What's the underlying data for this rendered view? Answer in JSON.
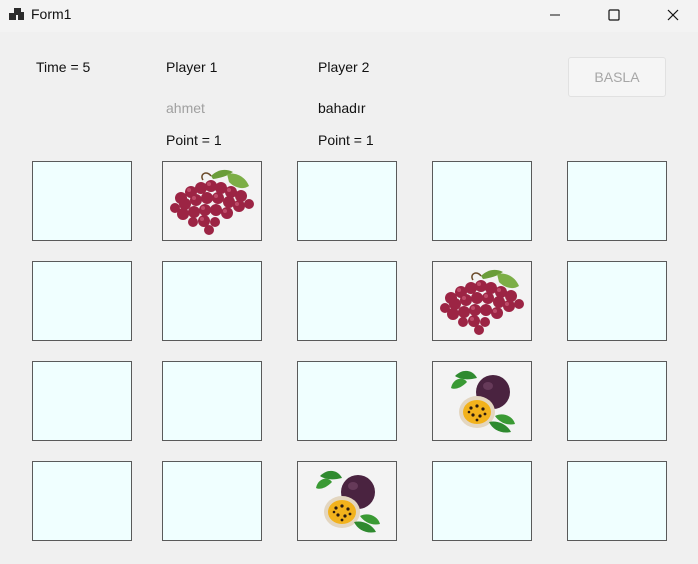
{
  "window": {
    "title": "Form1",
    "icon": "app-window-icon",
    "controls": [
      "minimize-icon",
      "maximize-icon",
      "close-icon"
    ]
  },
  "game": {
    "time_label": "Time = 5",
    "start_button": "BASLA",
    "player1": {
      "heading": "Player 1",
      "name": "ahmet",
      "points": "Point = 1"
    },
    "player2": {
      "heading": "Player 2",
      "name": "bahadır",
      "points": "Point = 1"
    }
  },
  "board": {
    "rows": 4,
    "columns": 5,
    "hidden_card_color": "#f0ffff",
    "revealed_cards": [
      {
        "row": 1,
        "column": 2,
        "image": "grapes-icon"
      },
      {
        "row": 2,
        "column": 4,
        "image": "grapes-icon"
      },
      {
        "row": 3,
        "column": 4,
        "image": "passion-fruit-icon"
      },
      {
        "row": 4,
        "column": 3,
        "image": "passion-fruit-icon"
      }
    ]
  }
}
